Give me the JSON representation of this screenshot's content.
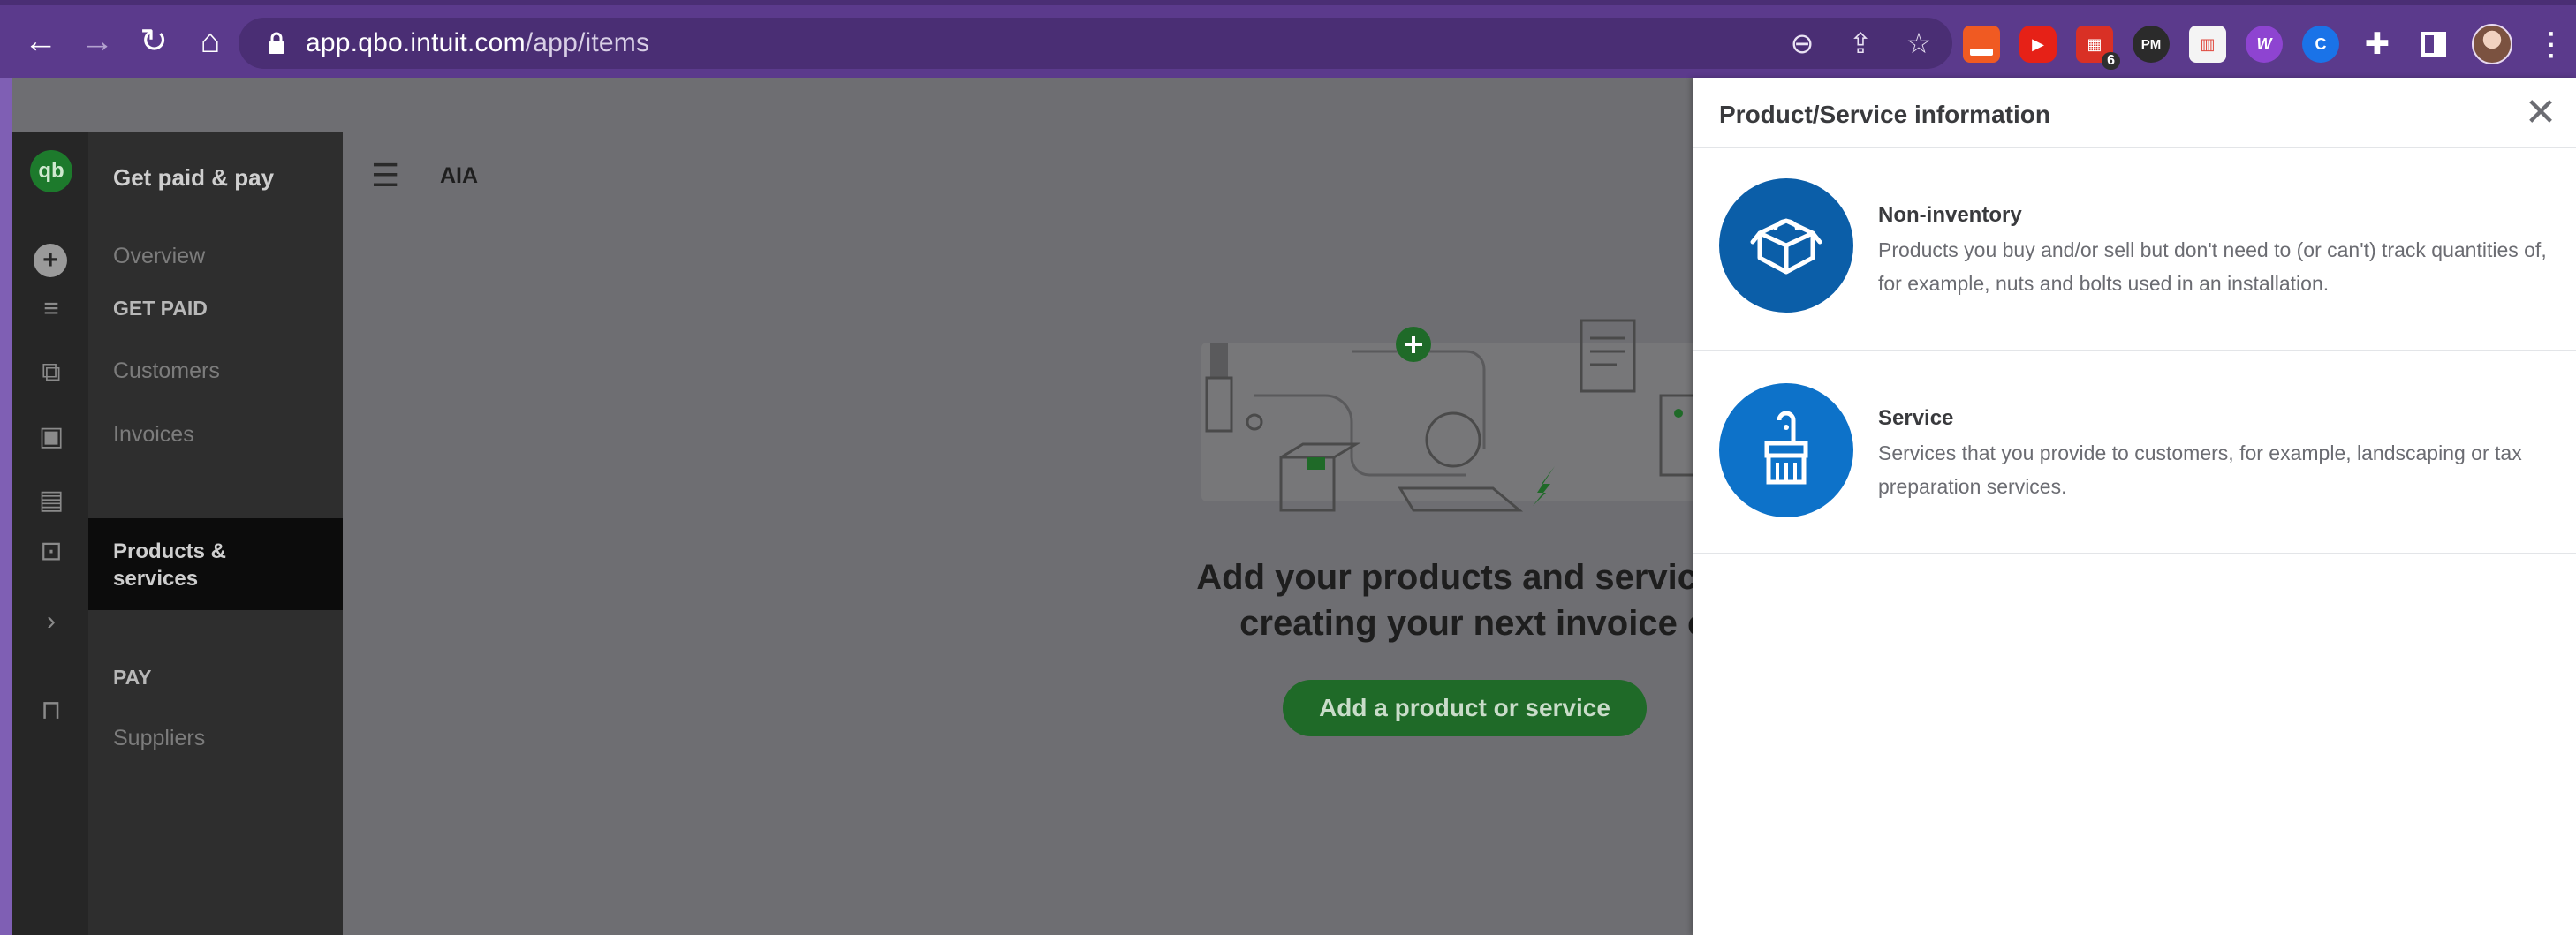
{
  "browser": {
    "url_host": "app.qbo.intuit.com",
    "url_path": "/app/items",
    "extensions": [
      {
        "name": "bookmark-ext",
        "color": "#f05a22",
        "label": ""
      },
      {
        "name": "youtube-ext",
        "color": "#e62117",
        "label": "▶"
      },
      {
        "name": "calendar-ext",
        "color": "#d93025",
        "label": "",
        "badge": "6"
      },
      {
        "name": "pm-ext",
        "color": "#2b2b2b",
        "label": "PM"
      },
      {
        "name": "toolbox-ext",
        "color": "#e04a3f",
        "label": ""
      },
      {
        "name": "w-ext",
        "color": "#8e44d1",
        "label": "W"
      },
      {
        "name": "c-ext",
        "color": "#1a73e8",
        "label": "C"
      }
    ]
  },
  "sidebar": {
    "title": "Get paid & pay",
    "overview": "Overview",
    "section_get_paid": "GET PAID",
    "customers": "Customers",
    "invoices": "Invoices",
    "products_services": "Products & services",
    "section_pay": "PAY",
    "suppliers": "Suppliers"
  },
  "topbar": {
    "company": "AIA"
  },
  "empty_state": {
    "heading_line1": "Add your products and services to s",
    "heading_line2": "creating your next invoice or re",
    "button": "Add a product or service"
  },
  "drawer": {
    "title": "Product/Service information",
    "options": [
      {
        "label": "Non-inventory",
        "description": "Products you buy and/or sell but don't need to (or can't) track quantities of, for example, nuts and bolts used in an installation.",
        "color": "#0b5ea8"
      },
      {
        "label": "Service",
        "description": "Services that you provide to customers, for example, landscaping or tax preparation services.",
        "color": "#0d72c9"
      }
    ]
  }
}
